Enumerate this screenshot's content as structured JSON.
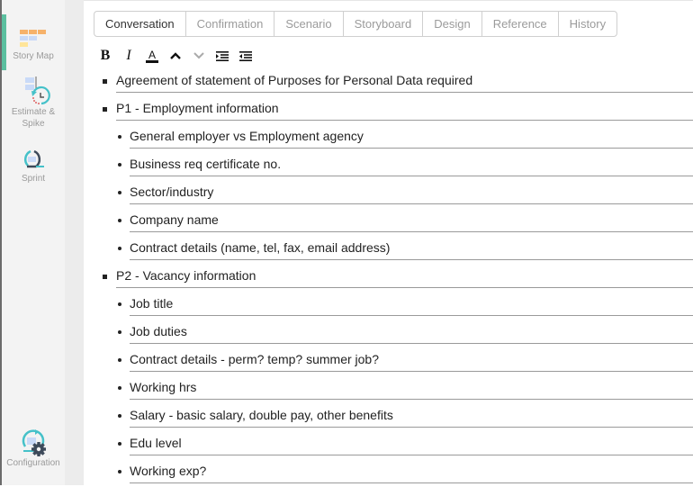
{
  "sidebar": {
    "items": [
      {
        "label": "Story Map",
        "icon": "story-map-icon",
        "active": true
      },
      {
        "label": "Estimate & Spike",
        "label_line1": "Estimate &",
        "label_line2": "Spike",
        "icon": "estimate-spike-icon",
        "active": false
      },
      {
        "label": "Sprint",
        "icon": "sprint-icon",
        "active": false
      }
    ],
    "footer": {
      "label": "Configuration",
      "icon": "configuration-icon"
    },
    "accent_color": "#5bbf9f"
  },
  "tabs": [
    {
      "label": "Conversation",
      "active": true
    },
    {
      "label": "Confirmation",
      "active": false
    },
    {
      "label": "Scenario",
      "active": false
    },
    {
      "label": "Storyboard",
      "active": false
    },
    {
      "label": "Design",
      "active": false
    },
    {
      "label": "Reference",
      "active": false
    },
    {
      "label": "History",
      "active": false
    }
  ],
  "toolbar": {
    "bold": "B",
    "italic": "I",
    "font_color": "A",
    "buttons": [
      "bold",
      "italic",
      "font-color",
      "move-up",
      "move-down",
      "indent",
      "outdent"
    ]
  },
  "content": {
    "items": [
      {
        "level": 1,
        "text": "Agreement of statement of Purposes for Personal Data required"
      },
      {
        "level": 1,
        "text": "P1 - Employment information"
      },
      {
        "level": 2,
        "text": "General employer vs Employment agency"
      },
      {
        "level": 2,
        "text": "Business req certificate no."
      },
      {
        "level": 2,
        "text": "Sector/industry"
      },
      {
        "level": 2,
        "text": "Company name"
      },
      {
        "level": 2,
        "text": "Contract details (name, tel, fax, email address)"
      },
      {
        "level": 1,
        "text": "P2 - Vacancy information"
      },
      {
        "level": 2,
        "text": "Job title"
      },
      {
        "level": 2,
        "text": "Job duties"
      },
      {
        "level": 2,
        "text": "Contract details - perm? temp? summer job?"
      },
      {
        "level": 2,
        "text": "Working hrs"
      },
      {
        "level": 2,
        "text": "Salary - basic salary, double pay, other benefits"
      },
      {
        "level": 2,
        "text": "Edu level"
      },
      {
        "level": 2,
        "text": "Working exp?"
      }
    ]
  }
}
